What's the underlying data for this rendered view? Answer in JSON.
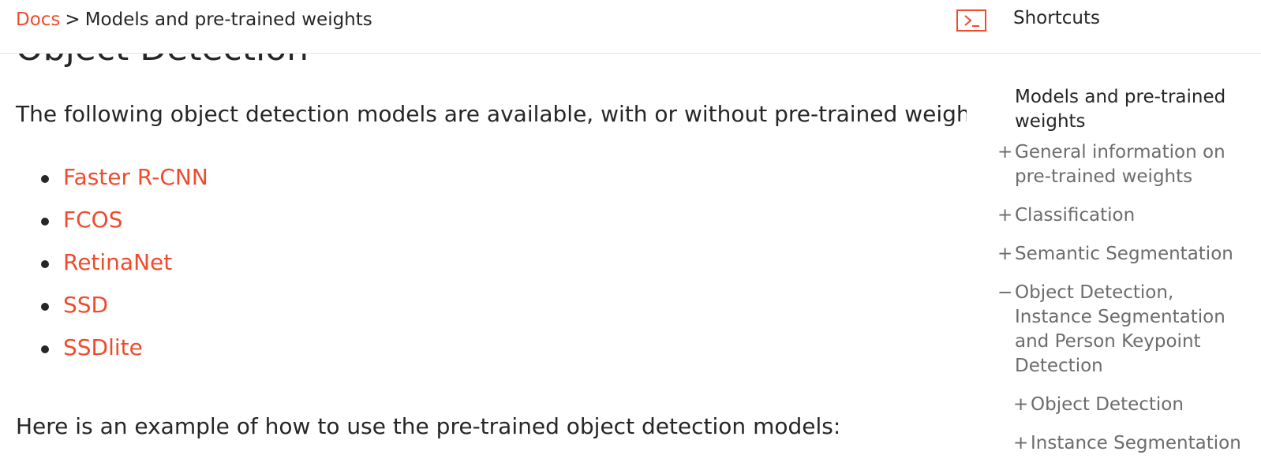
{
  "breadcrumb": {
    "docs_label": "Docs",
    "separator": ">",
    "current": "Models and pre-trained weights"
  },
  "shortcuts": {
    "icon": "terminal-icon",
    "label": "Shortcuts"
  },
  "main": {
    "section_title": "Object Detection",
    "intro": "The following object detection models are available, with or without pre-trained weights:",
    "models": [
      "Faster R-CNN",
      "FCOS",
      "RetinaNet",
      "SSD",
      "SSDlite"
    ],
    "example": "Here is an example of how to use the pre-trained object detection models:"
  },
  "toc": {
    "title": "Models and pre-trained weights",
    "items": [
      {
        "sign": "+",
        "label": "General information on pre-trained weights"
      },
      {
        "sign": "+",
        "label": "Classification"
      },
      {
        "sign": "+",
        "label": "Semantic Segmentation"
      },
      {
        "sign": "−",
        "label": "Object Detection, Instance Segmentation and Person Keypoint Detection"
      }
    ],
    "subitems": [
      {
        "sign": "+",
        "label": "Object Detection"
      },
      {
        "sign": "+",
        "label": "Instance Segmentation"
      }
    ]
  },
  "colors": {
    "accent": "#ee4c2c",
    "text": "#262626",
    "muted": "#6c6c6d"
  }
}
